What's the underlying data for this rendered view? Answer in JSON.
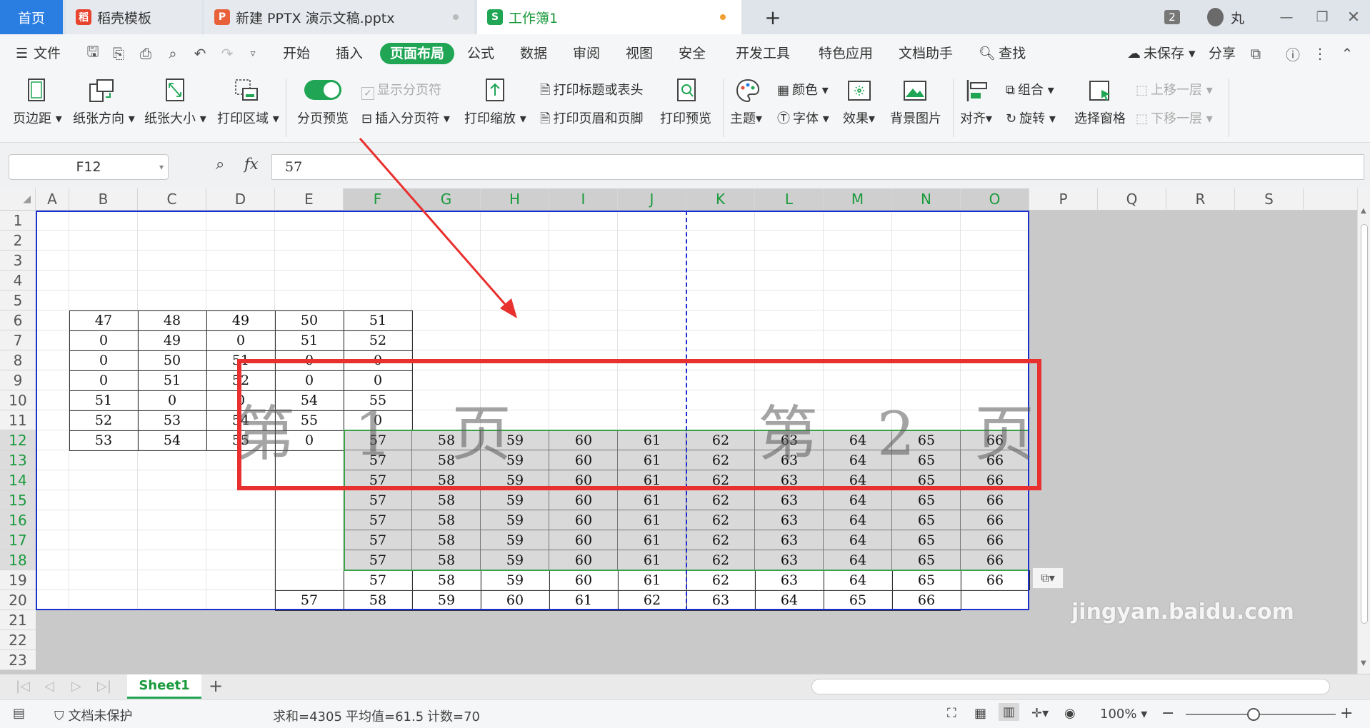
{
  "tabs": [
    {
      "label": "首页",
      "active": false
    },
    {
      "label": "稻壳模板",
      "icon": "docer-icon"
    },
    {
      "label": "新建 PPTX 演示文稿.pptx",
      "icon": "ppt-icon"
    },
    {
      "label": "工作簿1",
      "icon": "sheet-icon"
    }
  ],
  "window": {
    "badge": "2",
    "user": "丸"
  },
  "menu": {
    "file": "文件",
    "items": [
      "开始",
      "插入",
      "页面布局",
      "公式",
      "数据",
      "审阅",
      "视图",
      "安全",
      "开发工具",
      "特色应用",
      "文档助手"
    ],
    "search": "查找",
    "unsaved": "未保存",
    "share": "分享"
  },
  "ribbon": {
    "margin": "页边距",
    "orientation": "纸张方向",
    "size": "纸张大小",
    "print_area": "打印区域",
    "break_preview": "分页预览",
    "show_breaks": "显示分页符",
    "insert_break": "插入分页符",
    "print_scale": "打印缩放",
    "print_titles": "打印标题或表头",
    "header_footer": "打印页眉和页脚",
    "print_preview": "打印预览",
    "theme": "主题",
    "color": "颜色",
    "font": "字体",
    "effect": "效果",
    "bg_image": "背景图片",
    "align": "对齐",
    "group": "组合",
    "rotate": "旋转",
    "select_pane": "选择窗格",
    "bring_forward": "上移一层",
    "send_backward": "下移一层"
  },
  "formula": {
    "cell_ref": "F12",
    "fx": "fx",
    "value": "57"
  },
  "columns": [
    "A",
    "B",
    "C",
    "D",
    "E",
    "F",
    "G",
    "H",
    "I",
    "J",
    "K",
    "L",
    "M",
    "N",
    "O",
    "P",
    "Q",
    "R",
    "S"
  ],
  "rows": [
    "1",
    "2",
    "3",
    "4",
    "5",
    "6",
    "7",
    "8",
    "9",
    "10",
    "11",
    "12",
    "13",
    "14",
    "15",
    "16",
    "17",
    "18",
    "19",
    "20",
    "21",
    "22",
    "23"
  ],
  "table_left": [
    [
      "47",
      "48",
      "49",
      "50",
      "51"
    ],
    [
      "0",
      "49",
      "0",
      "51",
      "52"
    ],
    [
      "0",
      "50",
      "51",
      "0",
      "0"
    ],
    [
      "0",
      "51",
      "52",
      "0",
      "0"
    ],
    [
      "51",
      "0",
      "0",
      "54",
      "55"
    ],
    [
      "52",
      "53",
      "54",
      "55",
      "0"
    ],
    [
      "53",
      "54",
      "55",
      "0",
      "57"
    ]
  ],
  "block_row": [
    "57",
    "58",
    "59",
    "60",
    "61",
    "62",
    "63",
    "64",
    "65",
    "66"
  ],
  "row20": [
    "57",
    "58",
    "59",
    "60",
    "61",
    "62",
    "63",
    "64",
    "65",
    "66"
  ],
  "pages": {
    "page1": "第 1 页",
    "page2": "第 2 页"
  },
  "sheet": {
    "name": "Sheet1"
  },
  "status": {
    "protect": "文档未保护",
    "sum": "求和=4305",
    "avg": "平均值=61.5",
    "count": "计数=70",
    "zoom": "100%"
  },
  "watermark": "jingyan.baidu.com",
  "accent": "#1fa554"
}
